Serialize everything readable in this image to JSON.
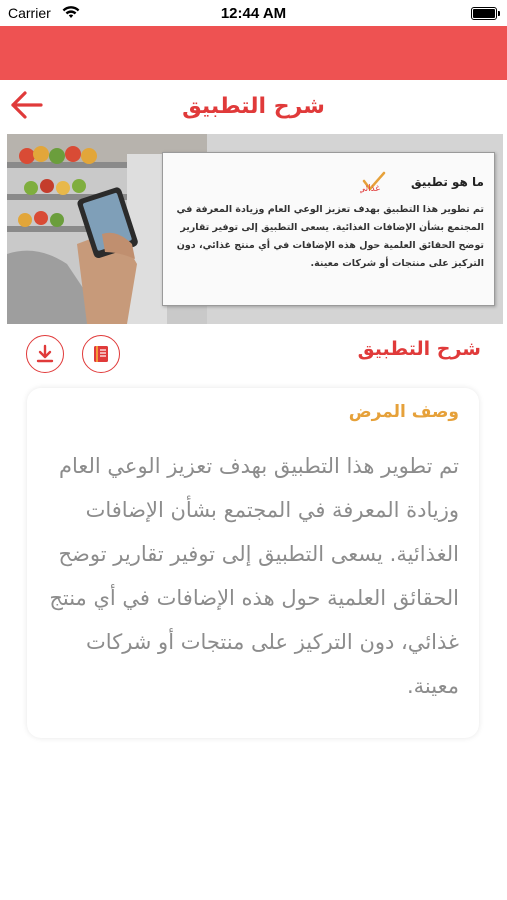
{
  "status": {
    "carrier": "Carrier",
    "time": "12:44 AM"
  },
  "nav": {
    "title": "شرح التطبيق"
  },
  "banner": {
    "card_title": "ما هو تطبيق",
    "logo_text": "غذائي",
    "card_body": "تم تطوير هذا التطبيق بهدف تعزيز الوعي العام وزيادة المعرفة في المجتمع بشأن الإضافات الغذائية. يسعى التطبيق إلى توفير تقارير توضح الحقائق العلمية حول هذه الإضافات في أي منتج غذائي، دون التركيز على منتجات أو شركات معينة."
  },
  "section": {
    "heading": "شرح التطبيق"
  },
  "description": {
    "title": "وصف المرض",
    "body": "تم تطوير هذا التطبيق بهدف تعزيز الوعي العام وزيادة المعرفة في المجتمع بشأن الإضافات الغذائية. يسعى التطبيق إلى توفير تقارير توضح الحقائق العلمية حول هذه الإضافات في أي منتج غذائي، دون التركيز على منتجات أو شركات معينة."
  },
  "icons": {
    "back": "back-arrow-icon",
    "download": "download-icon",
    "book": "book-icon",
    "wifi": "wifi-icon",
    "battery": "battery-icon"
  },
  "colors": {
    "brand_red": "#ee5252",
    "title_red": "#e03a3a",
    "accent_orange": "#e6a13a",
    "body_gray": "#8c8c8c"
  }
}
